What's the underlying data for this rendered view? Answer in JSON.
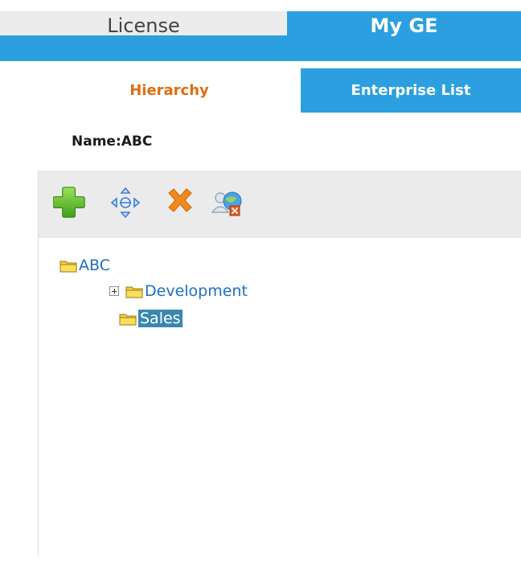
{
  "top_tabs": {
    "license": "License",
    "my_ge": "My GE"
  },
  "sub_tabs": {
    "hierarchy": "Hierarchy",
    "enterprise_list": "Enterprise List"
  },
  "name_label": "Name:ABC",
  "toolbar": {
    "buttons": [
      "add-icon",
      "move-icon",
      "delete-icon",
      "remove-user-icon"
    ]
  },
  "tree": {
    "root": "ABC",
    "children": [
      {
        "label": "Development",
        "expandable": true
      },
      {
        "label": "Sales",
        "expandable": false,
        "selected": true
      }
    ]
  },
  "colors": {
    "accent_blue": "#2c9fe0",
    "hierarchy_orange": "#e06d12",
    "tree_link": "#1f6fc3",
    "selected_bg": "#3a87b2"
  }
}
